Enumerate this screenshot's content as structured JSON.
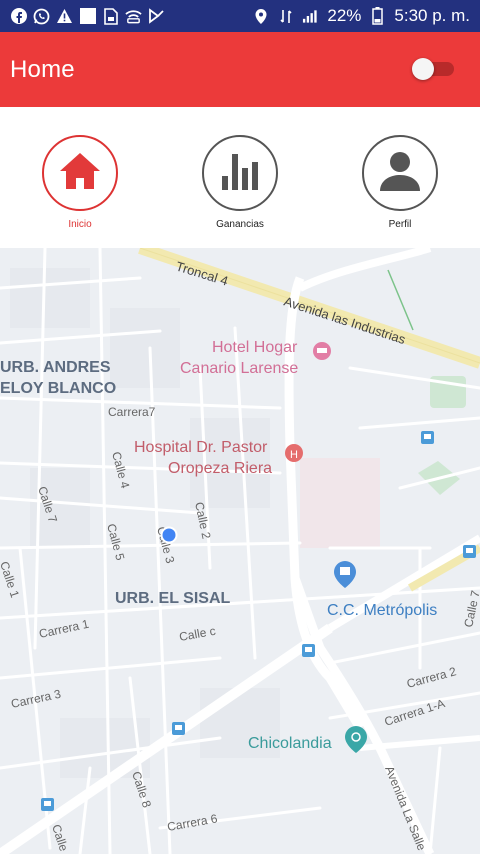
{
  "status_bar": {
    "icons_left": [
      "facebook-icon",
      "whatsapp-icon",
      "warning-icon",
      "image-icon",
      "file-icon",
      "wifi-icon",
      "media-icon"
    ],
    "battery": "22%",
    "time": "5:30 p. m."
  },
  "app_bar": {
    "title": "Home",
    "toggle_on": false
  },
  "nav": {
    "items": [
      {
        "label": "Inicio",
        "icon": "home-icon",
        "active": true
      },
      {
        "label": "Ganancias",
        "icon": "bar-chart-icon",
        "active": false
      },
      {
        "label": "Perfil",
        "icon": "person-icon",
        "active": false
      }
    ]
  },
  "map": {
    "labels": {
      "troncal": "Troncal 4",
      "avenida_industrias": "Avenida las Industrias",
      "hotel_1": "Hotel Hogar",
      "hotel_2": "Canario Larense",
      "urb_andres_1": "URB. ANDRES",
      "urb_andres_2": "ELOY BLANCO",
      "carrera7": "Carrera7",
      "hospital_1": "Hospital Dr. Pastor",
      "hospital_2": "Oropeza Riera",
      "calle4": "Calle 4",
      "calle7": "Calle 7",
      "calle2": "Calle 2",
      "calle5": "Calle 5",
      "calle3": "Calle 3",
      "calle1": "Calle 1",
      "urb_sisal": "URB. EL SISAL",
      "cc_metropolis": "C.C. Metrópolis",
      "carrera1": "Carrera 1",
      "calle_c": "Calle c",
      "calle7_right": "Calle 7",
      "carrera2": "Carrera 2",
      "carrera3": "Carrera 3",
      "carrera1a": "Carrera 1-A",
      "chicolandia": "Chicolandia",
      "calle8": "Calle 8",
      "carrera6": "Carrera 6",
      "avenida_lasalle": "Avenida La Salle",
      "calle_bottom": "Calle"
    }
  }
}
